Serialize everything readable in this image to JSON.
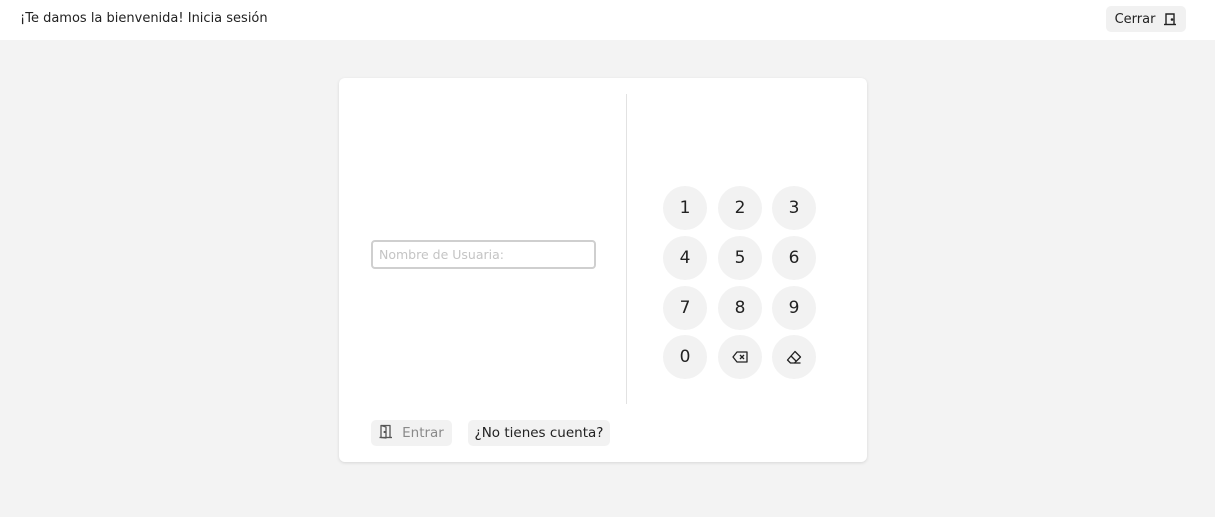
{
  "header": {
    "welcome_text": "¡Te damos la bienvenida! Inicia sesión",
    "close_label": "Cerrar",
    "close_icon": "door-icon"
  },
  "login": {
    "username_placeholder": "Nombre de Usuaria:",
    "username_value": "",
    "enter_label": "Entrar",
    "enter_icon": "door-open-icon",
    "signup_label": "¿No tienes cuenta?"
  },
  "keypad": {
    "keys": [
      "1",
      "2",
      "3",
      "4",
      "5",
      "6",
      "7",
      "8",
      "9",
      "0"
    ],
    "backspace_icon": "backspace-icon",
    "clear_icon": "eraser-icon"
  }
}
